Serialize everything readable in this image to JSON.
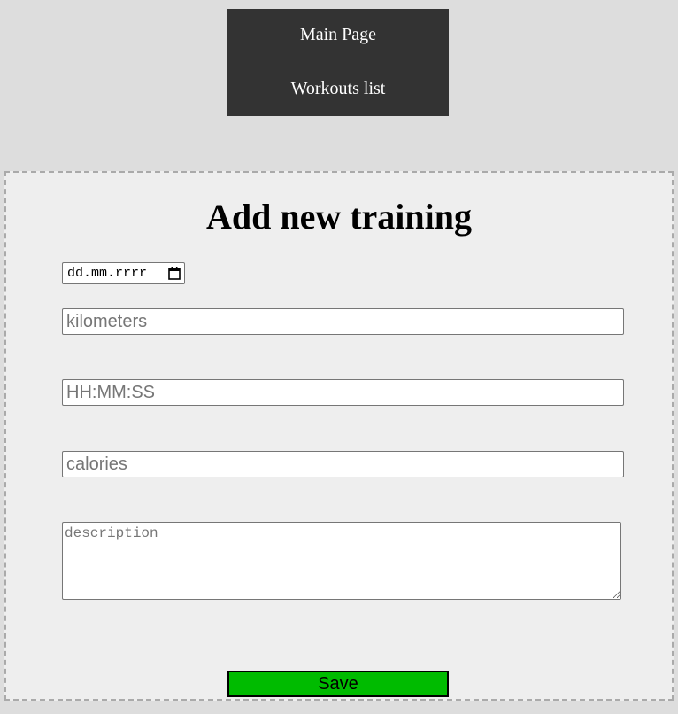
{
  "nav": {
    "items": [
      {
        "label": "Main Page"
      },
      {
        "label": "Workouts list"
      }
    ]
  },
  "form": {
    "title": "Add new training",
    "date_placeholder": "dd.mm.rrrr",
    "kilometers_placeholder": "kilometers",
    "time_placeholder": "HH:MM:SS",
    "calories_placeholder": "calories",
    "description_placeholder": "description",
    "save_label": "Save"
  },
  "colors": {
    "page_background": "#dddddd",
    "nav_background": "#333333",
    "panel_background": "#eeeeee",
    "save_button": "#00bb00"
  },
  "icons": {
    "date_picker": "calendar-icon",
    "textarea_resize": "resize-grip-icon"
  }
}
